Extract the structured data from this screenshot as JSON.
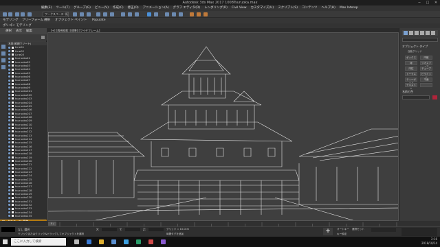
{
  "window": {
    "title": "Autodesk 3ds Max 2017     1008Tsuruoka.max",
    "controls": [
      "─",
      "□",
      "✕"
    ]
  },
  "menubar": {
    "items": [
      "編集(E)",
      "ツール(T)",
      "グループ(G)",
      "ビュー(V)",
      "作成(C)",
      "修正(O)",
      "アニメーション(A)",
      "グラフ エディタ(D)",
      "レンダリング(R)",
      "Civil View",
      "カスタマイズ(U)",
      "スクリプト(S)",
      "コンテンツ",
      "ヘルプ(H)",
      "Max Interop"
    ]
  },
  "toolbar1": {
    "workspace_dropdown": "ワークスペース: 既定"
  },
  "toolbar2": {
    "tabs": [
      "モデリング",
      "フリーフォーム",
      "選択",
      "オブジェクト ペイント",
      "Populate"
    ]
  },
  "toolbar3": {
    "label": "ポリゴン モデリング"
  },
  "explorer": {
    "tabs": [
      "選択",
      "表示",
      "編集"
    ],
    "column_header": "名前(昇順でソート)",
    "items": [
      "Line01",
      "Line02",
      "Line03",
      "tsuruoka01",
      "tsuruoka02",
      "tsuruoka03",
      "tsuruoka04",
      "tsuruoka05",
      "tsuruoka06",
      "tsuruoka07",
      "tsuruoka08",
      "tsuruoka09",
      "tsuruoka201",
      "tsuruoka202",
      "tsuruoka203",
      "tsuruoka204",
      "tsuruoka205",
      "tsuruoka206",
      "tsuruoka207",
      "tsuruoka208",
      "tsuruoka209",
      "tsuruoka210",
      "tsuruoka211",
      "tsuruoka212",
      "tsuruoka213",
      "tsuruoka214",
      "tsuruoka215",
      "tsuruoka216",
      "tsuruoka217",
      "tsuruoka218",
      "tsuruoka219",
      "tsuruoka220",
      "tsuruoka221",
      "tsuruoka222",
      "tsuruoka223",
      "tsuruoka224",
      "tsuruoka225",
      "tsuruoka226",
      "tsuruoka227",
      "tsuruoka228",
      "tsuruoka229",
      "tsuruoka230",
      "tsuruoka231",
      "tsuruoka232",
      "tsuruoka233",
      "tsuruoka234",
      "tsuruoka235",
      "tsuruoka236"
    ],
    "bottom_label": "ワークスペース: 既定"
  },
  "viewport": {
    "label": "[+] [透視投影] [標準] [ワイヤフレーム]"
  },
  "cmdpanel": {
    "section1": "オブジェクト タイプ",
    "autogrid": "自動グリッド",
    "buttons": [
      "ボックス",
      "円錐",
      "球",
      "ジオスフィア",
      "円柱",
      "チューブ",
      "トーラス",
      "ピラミッド",
      "ティーポット",
      "平面",
      "テキスト +",
      ""
    ],
    "section2": "名前と色",
    "accent": "#b0243a"
  },
  "timeline": {
    "frame": "0 / 100"
  },
  "status": {
    "objects": "なし 選択",
    "hint": "クリックまたはクリック&ドラッグしてオブジェクトを選択",
    "x_label": "X:",
    "y_label": "Y:",
    "z_label": "Z:",
    "grid": "グリッド = 10.0cm",
    "addtime": "時間タグを追加",
    "autokey": "オートキー",
    "setkey": "キー設定",
    "selected": "選択セット"
  },
  "taskbar": {
    "search_placeholder": "ここに入力して検索",
    "time": "2:16",
    "date": "2018/10/14"
  }
}
